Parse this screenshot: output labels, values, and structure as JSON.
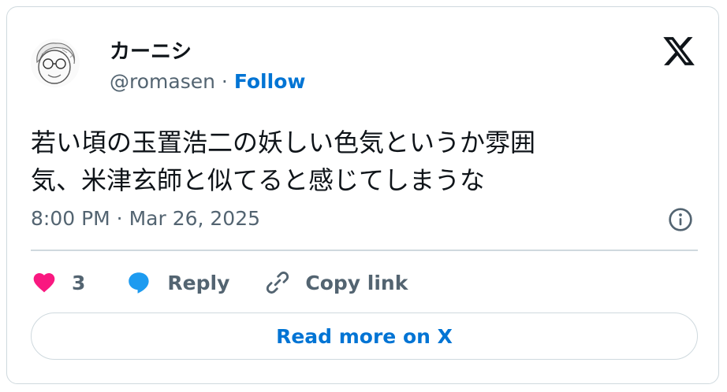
{
  "author": {
    "display_name": "カーニシ",
    "handle": "@romasen",
    "separator": "·",
    "follow_label": "Follow"
  },
  "logo_icon": "x-logo-icon",
  "tweet": {
    "text_line1": "若い頃の玉置浩二の妖しい色気というか雰囲",
    "text_line2": "気、米津玄師と似てると感じてしまうな",
    "timestamp": "8:00 PM · Mar 26, 2025"
  },
  "actions": {
    "like_count": "3",
    "reply_label": "Reply",
    "copy_link_label": "Copy link"
  },
  "read_more_label": "Read more on X",
  "colors": {
    "link": "#0074d4",
    "like": "#f91880",
    "reply": "#1d9bf0",
    "muted": "#536471",
    "border": "#cfd9de"
  }
}
